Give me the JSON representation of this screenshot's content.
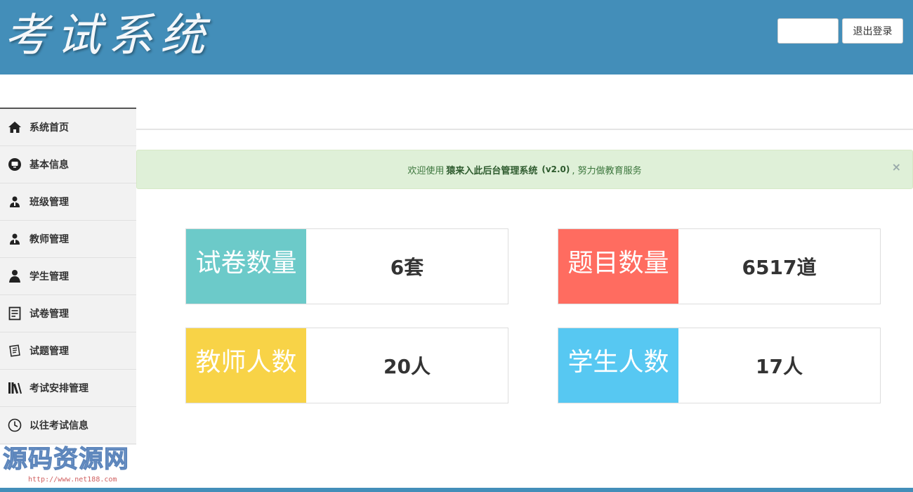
{
  "header": {
    "logo": "考试系统",
    "user_name": "",
    "logout_label": "退出登录"
  },
  "sidebar": {
    "items": [
      {
        "label": "系统首页",
        "icon": "home-icon"
      },
      {
        "label": "基本信息",
        "icon": "info-icon"
      },
      {
        "label": "班级管理",
        "icon": "group-icon"
      },
      {
        "label": "教师管理",
        "icon": "teacher-icon"
      },
      {
        "label": "学生管理",
        "icon": "student-icon"
      },
      {
        "label": "试卷管理",
        "icon": "paper-icon"
      },
      {
        "label": "试题管理",
        "icon": "question-icon"
      },
      {
        "label": "考试安排管理",
        "icon": "books-icon"
      },
      {
        "label": "以往考试信息",
        "icon": "clock-icon"
      }
    ]
  },
  "alert": {
    "prefix": "欢迎使用",
    "system_name": "猿来入此后台管理系统",
    "version": "(v2.0)",
    "suffix": ", 努力做教育服务",
    "close_symbol": "×"
  },
  "stats": [
    {
      "label": "试卷数量",
      "value": "6套",
      "color": "#6ccac9"
    },
    {
      "label": "题目数量",
      "value": "6517道",
      "color": "#ff6c60"
    },
    {
      "label": "教师人数",
      "value": "20人",
      "color": "#f8d347"
    },
    {
      "label": "学生人数",
      "value": "17人",
      "color": "#57c8f2"
    }
  ],
  "watermark": {
    "title": "源码资源网",
    "url": "http://www.net188.com"
  },
  "colors": {
    "header_bg": "#438eb9",
    "alert_bg": "#dff0d8"
  }
}
